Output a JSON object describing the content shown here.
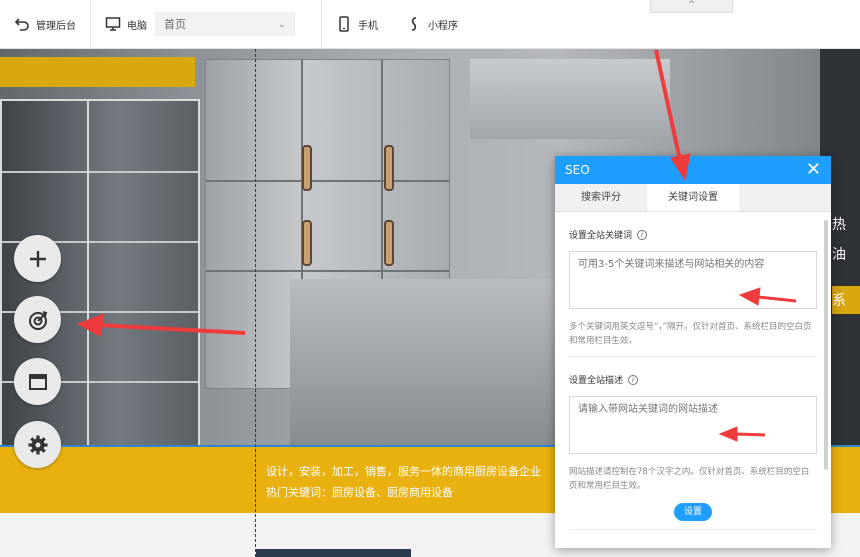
{
  "toolbar": {
    "back_label": "管理后台",
    "desktop_label": "电脑",
    "page_select_value": "首页",
    "mobile_label": "手机",
    "miniapp_label": "小程序",
    "collapse_glyph": "^"
  },
  "left_tools": [
    {
      "icon": "plus-icon"
    },
    {
      "icon": "target-icon"
    },
    {
      "icon": "layout-icon"
    },
    {
      "icon": "gear-icon"
    }
  ],
  "site_background": {
    "band_line1": "设计，安装，加工，销售，服务一体的商用厨房设备企业",
    "band_line2": "热门关键词：厨房设备、厨房商用设备",
    "right_text_1": "热",
    "right_text_2": "油",
    "right_text_3": "系",
    "right_text_4": "油"
  },
  "seo_dialog": {
    "title": "SEO",
    "close_glyph": "✕",
    "tabs": [
      {
        "label": "搜索评分",
        "active": false
      },
      {
        "label": "关键词设置",
        "active": true
      }
    ],
    "keywords": {
      "label": "设置全站关键词",
      "info_glyph": "i",
      "placeholder": "可用3-5个关键词来描述与网站相关的内容",
      "help": "多个关键词用英文逗号“，”隔开。仅针对首页、系统栏目的空白页和常用栏目生效。"
    },
    "description": {
      "label": "设置全站描述",
      "info_glyph": "i",
      "placeholder": "请输入带网站关键词的网站描述",
      "help": "网站描述请控制在78个汉字之内。仅针对首页、系统栏目的空白页和常用栏目生效。"
    },
    "submit_label": "设置"
  },
  "colors": {
    "accent_blue": "#1e9eff",
    "brand_yellow": "#e8b10f",
    "annotation_red": "#ee3b3b"
  }
}
